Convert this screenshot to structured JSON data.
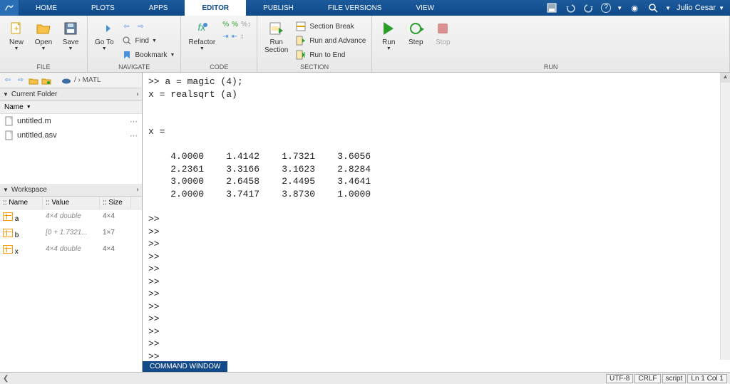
{
  "tabs": [
    "HOME",
    "PLOTS",
    "APPS",
    "EDITOR",
    "PUBLISH",
    "FILE VERSIONS",
    "VIEW"
  ],
  "active_tab_index": 3,
  "user": "Julio Cesar",
  "toolstrip": {
    "groups": {
      "file": {
        "label": "FILE",
        "new": "New",
        "open": "Open",
        "save": "Save"
      },
      "navigate": {
        "label": "NAVIGATE",
        "goto": "Go To",
        "find": "Find",
        "bookmark": "Bookmark"
      },
      "code": {
        "label": "CODE",
        "refactor": "Refactor"
      },
      "section": {
        "label": "SECTION",
        "run_section": "Run\nSection",
        "break": "Section Break",
        "advance": "Run and Advance",
        "toend": "Run to End"
      },
      "run": {
        "label": "RUN",
        "run": "Run",
        "step": "Step",
        "stop": "Stop"
      }
    }
  },
  "address_path": "/  ›  MATL",
  "current_folder": {
    "title": "Current Folder",
    "col": "Name",
    "files": [
      {
        "name": "untitled.m"
      },
      {
        "name": "untitled.asv"
      }
    ]
  },
  "workspace": {
    "title": "Workspace",
    "cols": [
      "Name",
      "Value",
      "Size"
    ],
    "rows": [
      {
        "name": "a",
        "value": "4×4 double",
        "size": "4×4"
      },
      {
        "name": "b",
        "value": "[0 + 1.7321...",
        "size": "1×7"
      },
      {
        "name": "x",
        "value": "4×4 double",
        "size": "4×4"
      }
    ]
  },
  "command_window": {
    "tab_label": "COMMAND WINDOW",
    "lines": [
      ">> a = magic (4);",
      "x = realsqrt (a)",
      "",
      "",
      "x =",
      "",
      "    4.0000    1.4142    1.7321    3.6056",
      "    2.2361    3.3166    3.1623    2.8284",
      "    3.0000    2.6458    2.4495    3.4641",
      "    2.0000    3.7417    3.8730    1.0000",
      "",
      ">>",
      ">>",
      ">>",
      ">>",
      ">>",
      ">>",
      ">>",
      ">>",
      ">>",
      ">>",
      ">>",
      ">>"
    ]
  },
  "status": {
    "encoding": "UTF-8",
    "eol": "CRLF",
    "mode": "script",
    "pos": "Ln 1  Col 1"
  }
}
